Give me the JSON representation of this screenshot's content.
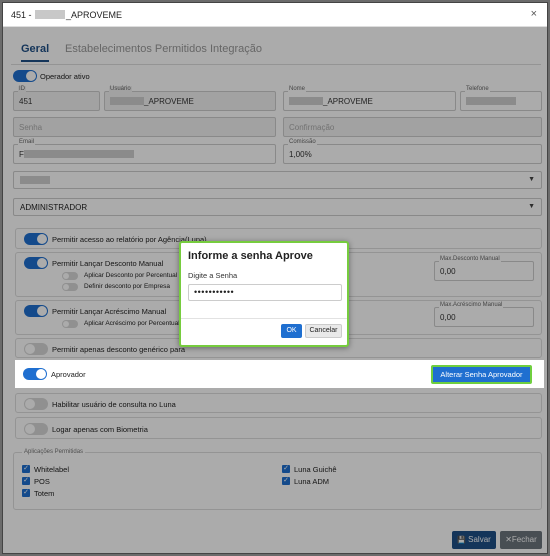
{
  "window": {
    "title_prefix": "451 - ",
    "title_suffix": "_APROVEME",
    "close_icon": "×"
  },
  "tabs": [
    {
      "label": "Geral",
      "active": true
    },
    {
      "label": "Estabelecimentos Permitidos",
      "active": false
    },
    {
      "label": "Integração",
      "active": false
    }
  ],
  "operator_active": {
    "label": "Operador ativo",
    "on": true
  },
  "fields": {
    "id": {
      "caption": "ID",
      "value": "451"
    },
    "usuario": {
      "caption": "Usuário",
      "value": "_APROVEME"
    },
    "nome": {
      "caption": "Nome",
      "value": "_APROVEME"
    },
    "telefone": {
      "caption": "Telefone",
      "value": ""
    },
    "senha": {
      "placeholder": "Senha"
    },
    "confirmacao": {
      "placeholder": "Confirmação"
    },
    "email": {
      "caption": "Email",
      "value": "F"
    },
    "comissao": {
      "caption": "Comissão",
      "value": "1,00%"
    }
  },
  "select_blurred": {
    "value": ""
  },
  "select_role": {
    "value": "ADMINISTRADOR"
  },
  "permissions": {
    "relatorio": "Permitir acesso ao relatório por Agência(Luna)",
    "desconto_manual": "Permitir Lançar Desconto Manual",
    "desc_percentual": "Aplicar Desconto por Percentual (%)",
    "desc_empresa": "Definir desconto por Empresa",
    "max_desconto_caption": "Max.Desconto Manual",
    "max_desconto_value": "0,00",
    "acrescimo_manual": "Permitir Lançar Acréscimo Manual",
    "acr_percentual": "Aplicar Acréscimo por Percentual (%)",
    "max_acrescimo_caption": "Max.Acréscimo Manual",
    "max_acrescimo_value": "0,00",
    "desconto_generico": "Permitir apenas desconto genérico para",
    "aprovador": "Aprovador",
    "alterar_senha_button": "Alterar Senha Aprovador",
    "habilitar_consulta": "Habilitar usuário de consulta no Luna",
    "biometria": "Logar apenas com Biometria"
  },
  "apps": {
    "caption": "Aplicações Permitidas",
    "items": [
      "Whitelabel",
      "POS",
      "Totem",
      "Luna Guichê",
      "Luna ADM"
    ]
  },
  "modal": {
    "title": "Informe a senha Aprove",
    "label": "Digite a Senha",
    "password_mask": "•••••••••••",
    "ok": "OK",
    "cancel": "Cancelar"
  },
  "footer": {
    "save": "Salvar",
    "close": "Fechar",
    "save_icon": "💾",
    "close_icon": "✕"
  },
  "colors": {
    "primary": "#1f6fd0",
    "dark_blue": "#1f4f86",
    "highlight": "#76cc3e"
  }
}
